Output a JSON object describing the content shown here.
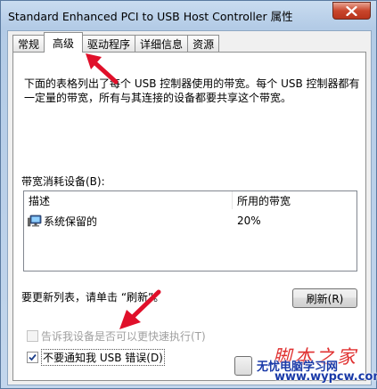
{
  "window": {
    "title": "Standard Enhanced PCI to USB Host Controller 属性"
  },
  "tabs": [
    {
      "label": "常规"
    },
    {
      "label": "高级"
    },
    {
      "label": "驱动程序"
    },
    {
      "label": "详细信息"
    },
    {
      "label": "资源"
    }
  ],
  "active_tab": "高级",
  "panel": {
    "description": "下面的表格列出了每个 USB 控制器使用的带宽。每个 USB 控制器都有一定量的带宽，所有与其连接的设备都要共享这个带宽。",
    "bandwidth_label": "带宽消耗设备(B):",
    "list": {
      "columns": [
        "描述",
        "所用的带宽"
      ],
      "rows": [
        {
          "name": "系统保留的",
          "bandwidth": "20%",
          "icon": "computer-icon"
        }
      ]
    },
    "refresh_hint": "要更新列表，请单击 “刷新”。",
    "refresh_button": "刷新(R)",
    "option1_label": "告诉我设备是否可以更快速执行(T)",
    "option1_checked": false,
    "option1_enabled": false,
    "option2_label": "不要通知我 USB 错误(D)",
    "option2_checked": true
  },
  "watermark": {
    "line1": "脚本之家",
    "line2": "无忧电脑学习网",
    "line3": "www.wypcw.com"
  },
  "colors": {
    "annotation_arrow": "#e0102a",
    "watermark_red": "#e03030",
    "watermark_blue": "#1a3aa8"
  }
}
